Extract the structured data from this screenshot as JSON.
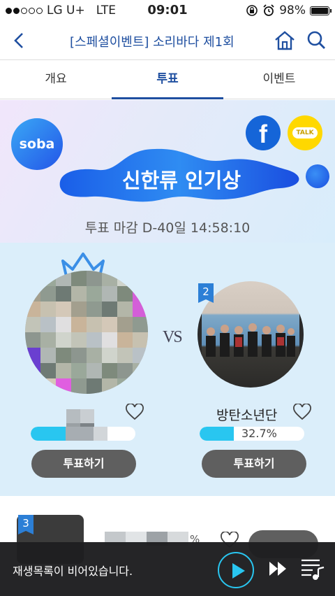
{
  "status": {
    "carrier": "LG U+",
    "network": "LTE",
    "time": "09:01",
    "battery": "98%"
  },
  "header": {
    "title": "[스페셜이벤트] 소리바다 제1회"
  },
  "tabs": [
    {
      "label": "개요"
    },
    {
      "label": "투표"
    },
    {
      "label": "이벤트"
    }
  ],
  "banner": {
    "logo": "soba",
    "award": "신한류 인기상",
    "deadline": "투표 마감 D-40일 14:58:10",
    "facebook": "f",
    "kakao": "TALK"
  },
  "vote": {
    "vs": "VS",
    "candidates": [
      {
        "rank": "1",
        "name": "",
        "percent": 0.67,
        "button": "투표하기"
      },
      {
        "rank": "2",
        "name": "방탄소년단",
        "percent": 0.327,
        "percent_label": "32.7%",
        "button": "투표하기"
      }
    ],
    "next_rank": "3",
    "next_percent_label": "%"
  },
  "player": {
    "message": "재생목록이 비어있습니다."
  },
  "colors": {
    "accent": "#1f4fa0",
    "bar": "#29c6f0",
    "button": "#5f5f5f"
  }
}
